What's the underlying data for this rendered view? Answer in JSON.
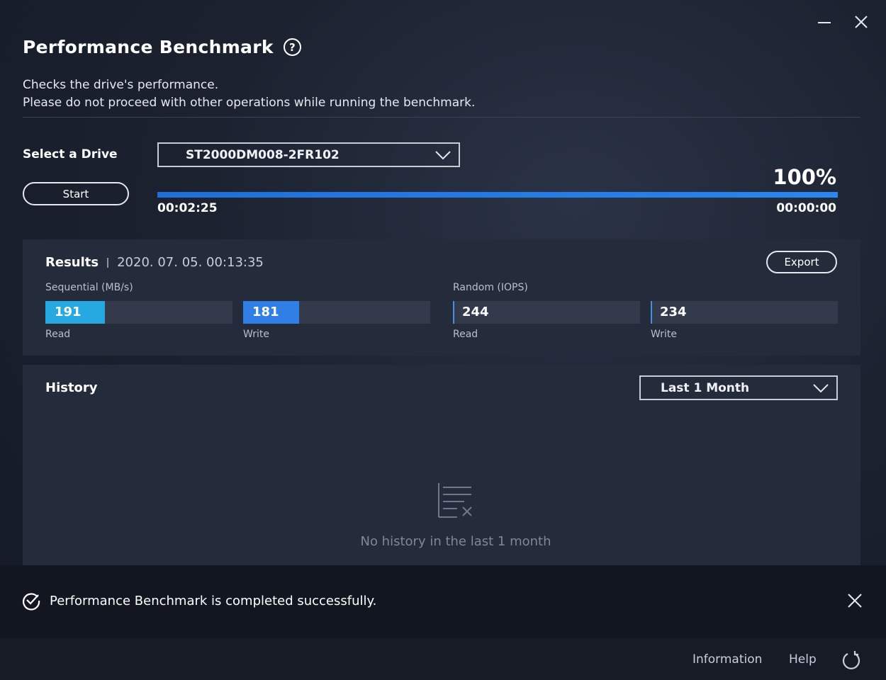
{
  "window": {
    "minimize_icon": "minimize-icon",
    "close_icon": "close-icon"
  },
  "header": {
    "title": "Performance Benchmark",
    "help_icon": "?"
  },
  "description": {
    "line1": "Checks the drive's performance.",
    "line2": "Please do not proceed with other operations while running the benchmark."
  },
  "drive": {
    "label": "Select a Drive",
    "selected": "ST2000DM008-2FR102"
  },
  "controls": {
    "start_label": "Start"
  },
  "progress": {
    "percent_text": "100%",
    "value": 1.0,
    "elapsed": "00:02:25",
    "remaining": "00:00:00"
  },
  "results": {
    "title": "Results",
    "timestamp": "2020. 07. 05. 00:13:35",
    "export_label": "Export",
    "sequential": {
      "label": "Sequential (MB/s)",
      "read": {
        "value": "191",
        "label": "Read",
        "fill": 0.32
      },
      "write": {
        "value": "181",
        "label": "Write",
        "fill": 0.3
      }
    },
    "random": {
      "label": "Random (IOPS)",
      "read": {
        "value": "244",
        "label": "Read"
      },
      "write": {
        "value": "234",
        "label": "Write"
      }
    }
  },
  "history": {
    "title": "History",
    "period_selected": "Last 1 Month",
    "empty_text": "No history in the last 1 month"
  },
  "toast": {
    "message": "Performance Benchmark is completed successfully."
  },
  "footer": {
    "information": "Information",
    "help": "Help"
  },
  "colors": {
    "accent_blue": "#2a86f0",
    "seq_read_fill": "#26a9e0",
    "seq_write_fill": "#2f7fe6"
  }
}
